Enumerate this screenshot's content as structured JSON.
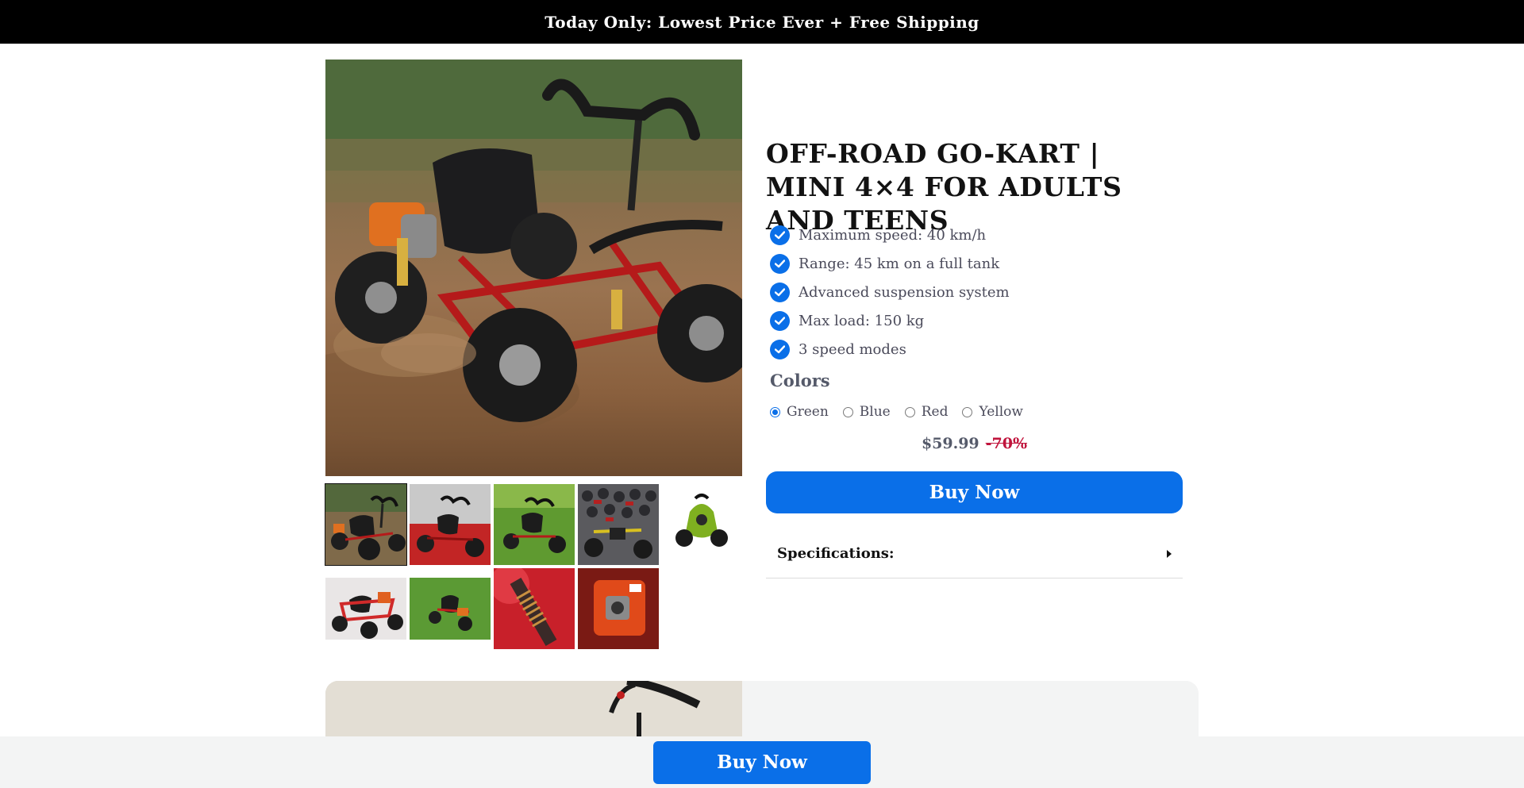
{
  "announcement": {
    "text": "Today Only: Lowest Price Ever + Free Shipping"
  },
  "product": {
    "title": "OFF-ROAD GO-KART | MINI 4×4 FOR ADULTS AND TEENS",
    "features": [
      {
        "icon": "check-circle-icon",
        "text": "Maximum speed: 40 km/h"
      },
      {
        "icon": "check-circle-icon",
        "text": "Range: 45 km on a full tank"
      },
      {
        "icon": "check-circle-icon",
        "text": "Advanced suspension system"
      },
      {
        "icon": "check-circle-icon",
        "text": "Max load: 150 kg"
      },
      {
        "icon": "check-circle-icon",
        "text": "3 speed modes"
      }
    ],
    "colors": {
      "label": "Colors",
      "options": [
        "Green",
        "Blue",
        "Red",
        "Yellow"
      ],
      "selected": "Green"
    },
    "price": "$59.99",
    "discount": "-70%",
    "buy_label": "Buy Now",
    "specs_label": "Specifications:"
  },
  "gallery": {
    "thumbnail_count": 9,
    "selected_index": 0
  },
  "sticky": {
    "buy_label": "Buy Now"
  },
  "theme": {
    "accent": "#0a6fe8",
    "discount_color": "#c0143c",
    "announcement_bg": "#000000",
    "sticky_bg": "#f3f4f4"
  }
}
